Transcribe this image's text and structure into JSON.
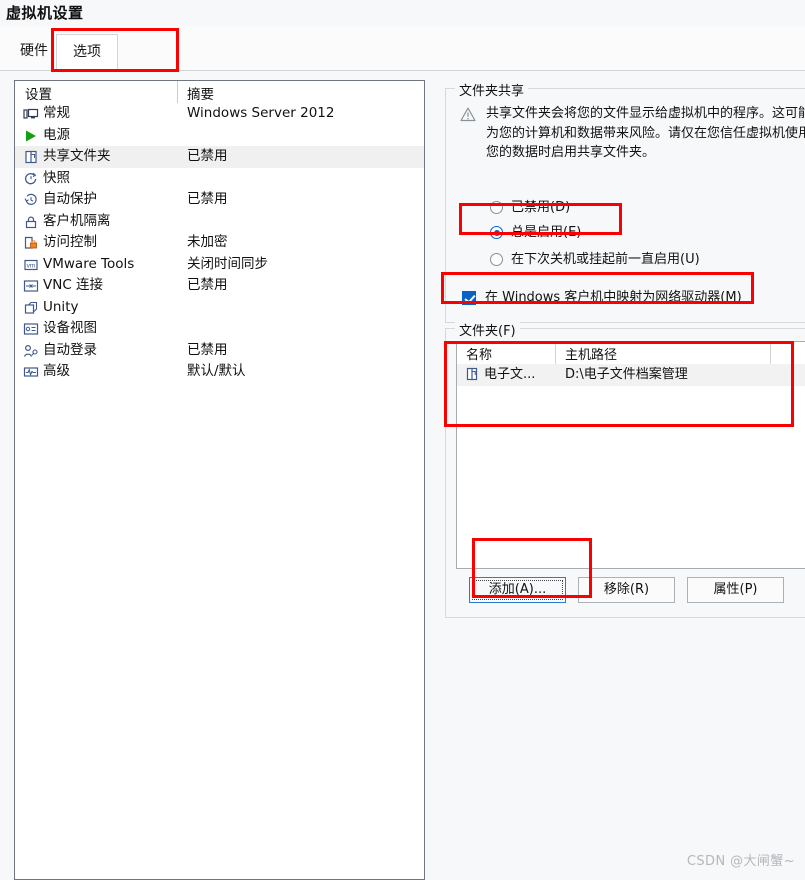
{
  "window": {
    "title": "虚拟机设置"
  },
  "tabs": [
    {
      "id": "hardware",
      "label": "硬件",
      "active": false
    },
    {
      "id": "options",
      "label": "选项",
      "active": true
    }
  ],
  "settings_list": {
    "columns": [
      "设置",
      "摘要"
    ],
    "rows": [
      {
        "icon": "monitor-icon",
        "label": "常规",
        "summary": "Windows Server 2012",
        "selected": false
      },
      {
        "icon": "play-icon",
        "label": "电源",
        "summary": "",
        "selected": false
      },
      {
        "icon": "folder-share-icon",
        "label": "共享文件夹",
        "summary": "已禁用",
        "selected": true
      },
      {
        "icon": "snapshot-icon",
        "label": "快照",
        "summary": "",
        "selected": false
      },
      {
        "icon": "clock-icon",
        "label": "自动保护",
        "summary": "已禁用",
        "selected": false
      },
      {
        "icon": "lock-icon",
        "label": "客户机隔离",
        "summary": "",
        "selected": false
      },
      {
        "icon": "access-lock-icon",
        "label": "访问控制",
        "summary": "未加密",
        "selected": false
      },
      {
        "icon": "vm-tools-icon",
        "label": "VMware Tools",
        "summary": "关闭时间同步",
        "selected": false
      },
      {
        "icon": "vnc-icon",
        "label": "VNC 连接",
        "summary": "已禁用",
        "selected": false
      },
      {
        "icon": "unity-icon",
        "label": "Unity",
        "summary": "",
        "selected": false
      },
      {
        "icon": "device-view-icon",
        "label": "设备视图",
        "summary": "",
        "selected": false
      },
      {
        "icon": "auto-login-icon",
        "label": "自动登录",
        "summary": "已禁用",
        "selected": false
      },
      {
        "icon": "advanced-icon",
        "label": "高级",
        "summary": "默认/默认",
        "selected": false
      }
    ]
  },
  "sharing": {
    "group_title": "文件夹共享",
    "warning_icon": "warning-triangle-icon",
    "warning_text": "共享文件夹会将您的文件显示给虚拟机中的程序。这可能为您的计算机和数据带来风险。请仅在您信任虚拟机使用您的数据时启用共享文件夹。",
    "radios": [
      {
        "id": "disabled",
        "label": "已禁用(D)",
        "checked": false
      },
      {
        "id": "always",
        "label": "总是启用(E)",
        "checked": true
      },
      {
        "id": "until-next",
        "label": "在下次关机或挂起前一直启用(U)",
        "checked": false
      }
    ],
    "map_drive": {
      "label": "在 Windows 客户机中映射为网络驱动器(M)",
      "checked": true
    }
  },
  "folders": {
    "group_title": "文件夹(F)",
    "columns": [
      "名称",
      "主机路径",
      ""
    ],
    "rows": [
      {
        "icon": "folder-share-icon",
        "name": "电子文...",
        "host_path": "D:\\电子文件档案管理",
        "enabled": true
      }
    ],
    "buttons": [
      {
        "id": "add",
        "label": "添加(A)...",
        "focused": true
      },
      {
        "id": "remove",
        "label": "移除(R)",
        "focused": false
      },
      {
        "id": "property",
        "label": "属性(P)",
        "focused": false
      }
    ]
  },
  "annotations": {
    "color": "#fb0000",
    "boxes": [
      "tab-options",
      "radio-always-enabled",
      "map-network-drive-checkbox",
      "folders-table",
      "add-button"
    ]
  },
  "watermark": {
    "text": "CSDN @大闸蟹~"
  }
}
